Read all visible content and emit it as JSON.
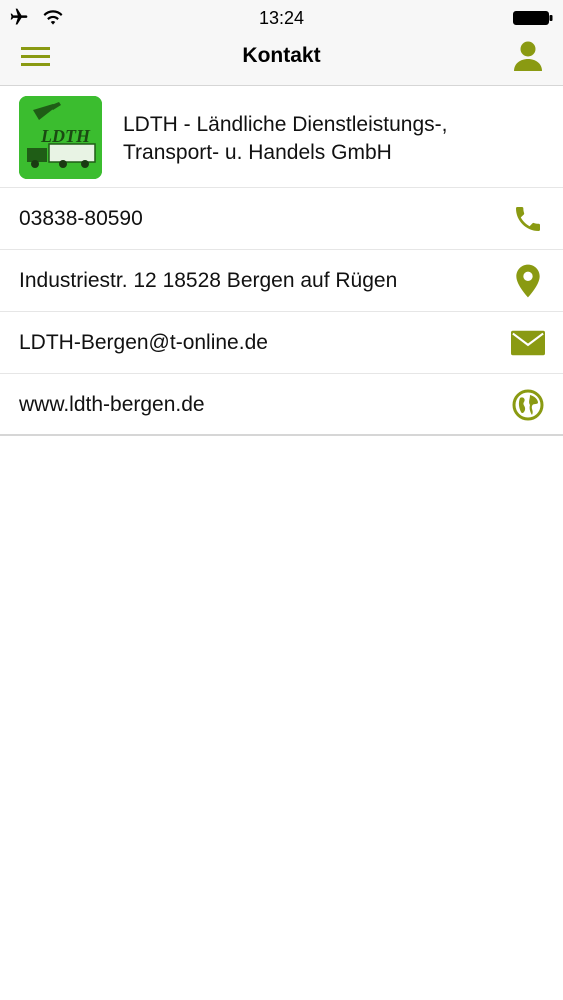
{
  "status_bar": {
    "time": "13:24",
    "icons": [
      "airplane-icon",
      "wifi-icon",
      "battery-icon"
    ]
  },
  "nav": {
    "title": "Kontakt",
    "left_icon": "menu-icon",
    "right_icon": "profile-icon"
  },
  "company": {
    "name_line1": "LDTH - Ländliche Dienstleistungs-,",
    "name_line2": "Transport- u. Handels GmbH",
    "logo_text": "LDTH"
  },
  "contacts": [
    {
      "label": "03838-80590",
      "icon": "phone-icon"
    },
    {
      "label": "Industriestr. 12 18528 Bergen auf Rügen",
      "icon": "location-pin-icon"
    },
    {
      "label": "LDTH-Bergen@t-online.de",
      "icon": "mail-icon"
    },
    {
      "label": "www.ldth-bergen.de",
      "icon": "globe-icon"
    }
  ],
  "colors": {
    "accent": "#8a9a12",
    "logo_bg": "#3bbd2f",
    "bar_bg": "#f7f7f7"
  }
}
